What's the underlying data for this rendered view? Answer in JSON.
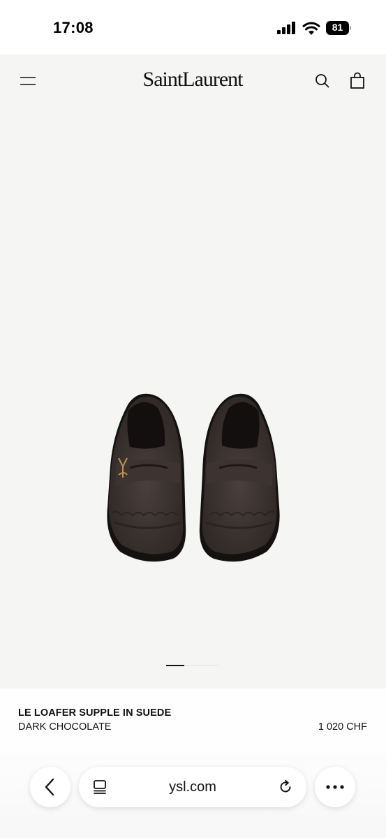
{
  "status_bar": {
    "time": "17:08",
    "battery_level": "81",
    "icons": [
      "cellular-signal-icon",
      "wifi-icon",
      "battery-icon"
    ]
  },
  "header": {
    "brand": "SaintLaurent",
    "icons": [
      "menu-icon",
      "search-icon",
      "shopping-bag-icon"
    ]
  },
  "carousel": {
    "image": "brown-suede-loafers-pair",
    "active_page": 1
  },
  "product": {
    "name": "LE LOAFER SUPPLE IN SUEDE",
    "color": "DARK CHOCOLATE",
    "price": "1 020 CHF"
  },
  "browser": {
    "address": "ysl.com",
    "icons": [
      "back-chevron-icon",
      "tabs-icon",
      "reload-icon",
      "more-icon"
    ]
  },
  "colors": {
    "hero_background": "#f5f5f3",
    "suede": "#3f3633",
    "sole": "#141211",
    "hardware": "#b89352"
  }
}
